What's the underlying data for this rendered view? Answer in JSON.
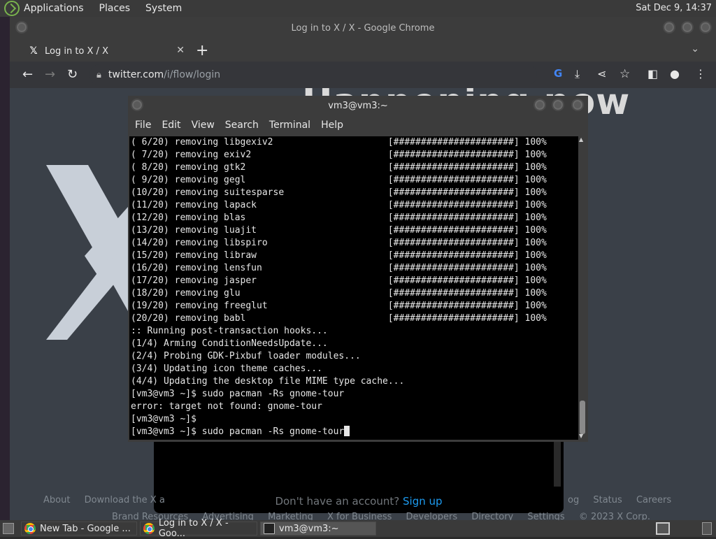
{
  "top_panel": {
    "menus": [
      "Applications",
      "Places",
      "System"
    ],
    "clock": "Sat Dec  9, 14:37"
  },
  "chrome": {
    "window_title": "Log in to X / X - Google Chrome",
    "tab_title": "Log in to X / X",
    "tab_favicon": "𝕏",
    "url_host": "twitter.com",
    "url_path": "/i/flow/login"
  },
  "x_page": {
    "heading": "Happening now",
    "signup_prompt": "Don't have an account?",
    "signup_link": "Sign up",
    "footer_row1": [
      "About",
      "Download the X a",
      "og",
      "Status",
      "Careers"
    ],
    "footer_row2": [
      "Brand Resources",
      "Advertising",
      "Marketing",
      "X for Business",
      "Developers",
      "Directory",
      "Settings",
      "© 2023 X Corp."
    ]
  },
  "terminal": {
    "title": "vm3@vm3:~",
    "menus": [
      "File",
      "Edit",
      "View",
      "Search",
      "Terminal",
      "Help"
    ],
    "lines": [
      "( 6/20) removing libgexiv2                     [######################] 100%",
      "( 7/20) removing exiv2                         [######################] 100%",
      "( 8/20) removing gtk2                          [######################] 100%",
      "( 9/20) removing gegl                          [######################] 100%",
      "(10/20) removing suitesparse                   [######################] 100%",
      "(11/20) removing lapack                        [######################] 100%",
      "(12/20) removing blas                          [######################] 100%",
      "(13/20) removing luajit                        [######################] 100%",
      "(14/20) removing libspiro                      [######################] 100%",
      "(15/20) removing libraw                        [######################] 100%",
      "(16/20) removing lensfun                       [######################] 100%",
      "(17/20) removing jasper                        [######################] 100%",
      "(18/20) removing glu                           [######################] 100%",
      "(19/20) removing freeglut                      [######################] 100%",
      "(20/20) removing babl                          [######################] 100%",
      ":: Running post-transaction hooks...",
      "(1/4) Arming ConditionNeedsUpdate...",
      "(2/4) Probing GDK-Pixbuf loader modules...",
      "(3/4) Updating icon theme caches...",
      "(4/4) Updating the desktop file MIME type cache...",
      "[vm3@vm3 ~]$ sudo pacman -Rs gnome-tour",
      "error: target not found: gnome-tour",
      "[vm3@vm3 ~]$"
    ],
    "prompt_line": "[vm3@vm3 ~]$ sudo pacman -Rs gnome-tour"
  },
  "taskbar": {
    "tasks": [
      "New Tab - Google ...",
      "Log in to X / X - Goo...",
      "vm3@vm3:~"
    ]
  },
  "colors": {
    "terminal_bg": "#000000",
    "x_blue": "#1d9bf0",
    "page_bg": "#3a4048"
  }
}
